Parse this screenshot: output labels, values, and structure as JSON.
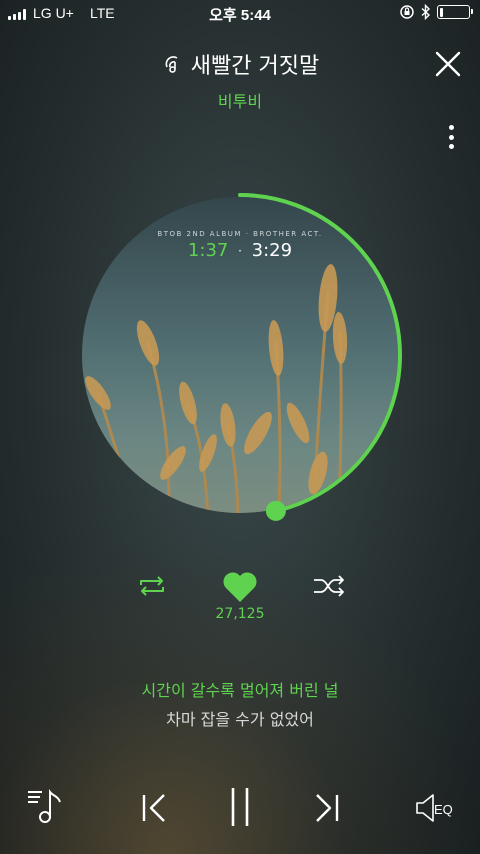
{
  "status_bar": {
    "carrier": "LG U+",
    "network": "LTE",
    "time": "오후 5:44",
    "battery_level": 0.12
  },
  "header": {
    "title": "새빨간 거짓말",
    "artist": "비투비"
  },
  "album": {
    "caption": "BTOB 2ND ALBUM · BROTHER ACT.",
    "current_time": "1:37",
    "separator": "·",
    "total_time": "3:29",
    "progress": 0.464
  },
  "controls": {
    "like_count": "27,125"
  },
  "lyrics": {
    "current": "시간이 갈수록 멀어져 버린 널",
    "next": "차마 잡을 수가 없었어"
  },
  "bottom_bar": {
    "eq_label": "EQ"
  },
  "colors": {
    "accent": "#5fd34f",
    "background": "#2b3536"
  }
}
